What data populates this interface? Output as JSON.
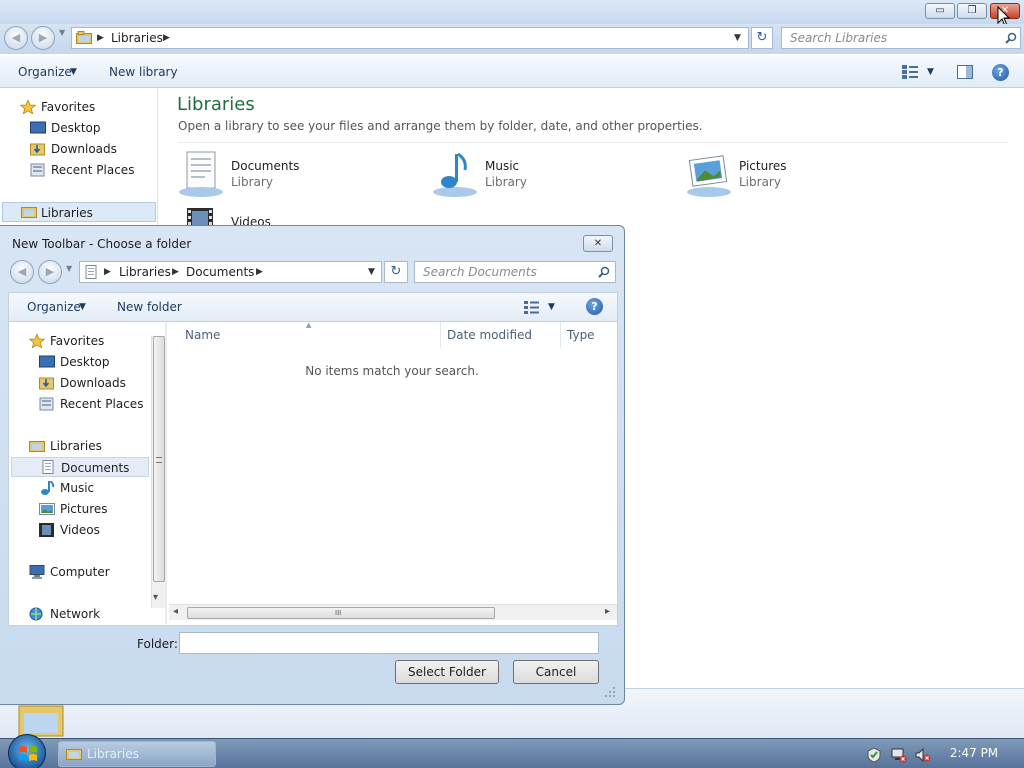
{
  "explorer": {
    "caption_buttons": {
      "minimize": "▭",
      "restore": "❐",
      "close": "✕"
    },
    "address": {
      "back_glyph": "◀",
      "forward_glyph": "▶",
      "crumbs": [
        "Libraries"
      ],
      "separator": "▶",
      "dropdown_glyph": "▼",
      "refresh_glyph": "↻"
    },
    "search": {
      "placeholder": "Search Libraries"
    },
    "commands": {
      "organize": "Organize",
      "organize_arrow": "▼",
      "new_library": "New library",
      "views_arrow": "▼",
      "help": "?"
    },
    "nav": {
      "favorites": {
        "label": "Favorites",
        "items": [
          "Desktop",
          "Downloads",
          "Recent Places"
        ]
      },
      "libraries": "Libraries"
    },
    "main": {
      "title": "Libraries",
      "description": "Open a library to see your files and arrange them by folder, date, and other properties.",
      "items": [
        {
          "name": "Documents",
          "type": "Library"
        },
        {
          "name": "Music",
          "type": "Library"
        },
        {
          "name": "Pictures",
          "type": "Library"
        },
        {
          "name": "Videos",
          "type": ""
        }
      ]
    }
  },
  "dialog": {
    "title": "New Toolbar - Choose a folder",
    "close_glyph": "✕",
    "address": {
      "back_glyph": "◀",
      "forward_glyph": "▶",
      "crumbs": [
        "Libraries",
        "Documents"
      ],
      "separator": "▶",
      "dropdown_glyph": "▼",
      "refresh_glyph": "↻"
    },
    "search": {
      "placeholder": "Search Documents"
    },
    "commands": {
      "organize": "Organize",
      "organize_arrow": "▼",
      "new_folder": "New folder",
      "views_arrow": "▼",
      "help": "?"
    },
    "nav": {
      "favorites": "Favorites",
      "favorite_items": [
        "Desktop",
        "Downloads",
        "Recent Places"
      ],
      "libraries": "Libraries",
      "library_items": [
        "Documents",
        "Music",
        "Pictures",
        "Videos"
      ],
      "selected": "Documents",
      "computer": "Computer",
      "network": "Network"
    },
    "columns": [
      "Name",
      "Date modified",
      "Type"
    ],
    "sort_indicator": "▲",
    "empty_message": "No items match your search.",
    "hscroll": {
      "left_arrow": "◂",
      "right_arrow": "▸",
      "grip": "III"
    },
    "vscroll": {
      "down_arrow": "▾"
    },
    "folder_label": "Folder:",
    "folder_value": "",
    "buttons": {
      "select": "Select Folder",
      "cancel": "Cancel"
    }
  },
  "taskbar": {
    "item_label": "Libraries",
    "clock": "2:47 PM"
  },
  "colors": {
    "accent_title": "#1e6f3d",
    "taskbar": "#6a86aa",
    "close_button": "#c7442a"
  }
}
